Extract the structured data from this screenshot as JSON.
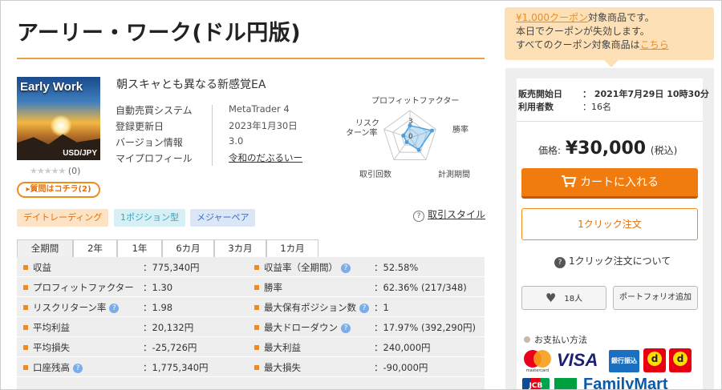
{
  "product": {
    "title": "アーリー・ワーク(ドル円版)",
    "tagline": "朝スキャとも異なる新感覚EA",
    "image_title": "Early Work",
    "image_pair": "USD/JPY",
    "stars": "★★★★★",
    "review_count": "(0)",
    "question_button": "▸質問はコチラ(2)"
  },
  "info": [
    {
      "key": "自動売買システム",
      "value": "MetaTrader 4"
    },
    {
      "key": "登録更新日",
      "value": "2023年1月30日"
    },
    {
      "key": "バージョン情報",
      "value": "3.0"
    },
    {
      "key": "マイプロフィール",
      "value": "令和のだぶるいー"
    }
  ],
  "radar": {
    "labels": {
      "top": "プロフィットファクター",
      "right_top": "勝率",
      "right_bottom": "計測期間",
      "bottom_left": "取引回数",
      "left_top_1": "リスク",
      "left_top_2": "ターン率"
    },
    "scale_labels": [
      "3",
      "0"
    ],
    "axis_order": [
      "プロフィットファクター",
      "勝率",
      "計測期間",
      "取引回数",
      "リスクリターン率"
    ],
    "values": [
      0.45,
      0.85,
      0.55,
      0.2,
      0.25
    ]
  },
  "tags": [
    "デイトレーディング",
    "1ポジション型",
    "メジャーペア"
  ],
  "trade_style": {
    "icon": "?",
    "label": "取引スタイル"
  },
  "tabs": [
    "全期間",
    "2年",
    "1年",
    "6カ月",
    "3カ月",
    "1カ月"
  ],
  "stats_left": [
    {
      "label": "収益",
      "value": "：775,340円",
      "help": false
    },
    {
      "label": "プロフィットファクター",
      "value": "：1.30",
      "help": false
    },
    {
      "label": "リスクリターン率",
      "value": "：1.98",
      "help": true
    },
    {
      "label": "平均利益",
      "value": "：20,132円",
      "help": false
    },
    {
      "label": "平均損失",
      "value": "：-25,726円",
      "help": false
    },
    {
      "label": "口座残高",
      "value": "：1,775,340円",
      "help": true
    }
  ],
  "stats_right": [
    {
      "label": "収益率（全期間）",
      "value": "：52.58%",
      "help": true
    },
    {
      "label": "勝率",
      "value": "：62.36% (217/348)",
      "help": false
    },
    {
      "label": "最大保有ポジション数",
      "value": "：1",
      "help": true
    },
    {
      "label": "最大ドローダウン",
      "value": "：17.97% (392,290円)",
      "help": true
    },
    {
      "label": "最大利益",
      "value": "：240,000円",
      "help": false
    },
    {
      "label": "最大損失",
      "value": "：-90,000円",
      "help": false
    }
  ],
  "coupon": {
    "amount_link": "¥1,000クーポン",
    "line1_rest": "対象商品です。",
    "line2": "本日でクーポンが失効します。",
    "line3_pre": "すべてのクーポン対象商品は",
    "line3_link": "こちら"
  },
  "sale": {
    "start_label": "販売開始日",
    "start_value": "：  2021年7月29日 10時30分",
    "users_label": "利用者数",
    "users_value": "：16名"
  },
  "price": {
    "label": "価格:",
    "amount": "¥30,000",
    "tax": "(税込)"
  },
  "buttons": {
    "cart": "カートに入れる",
    "one_click": "1クリック注文",
    "about_one_click": "1クリック注文について",
    "favorite_count": "18人",
    "portfolio": "ポートフォリオ追加"
  },
  "payment": {
    "title": "お支払い方法",
    "mastercard": "mastercard",
    "visa": "VISA",
    "bank": "銀行振込",
    "jcb": "JCB",
    "familymart": "FamilyMart"
  }
}
